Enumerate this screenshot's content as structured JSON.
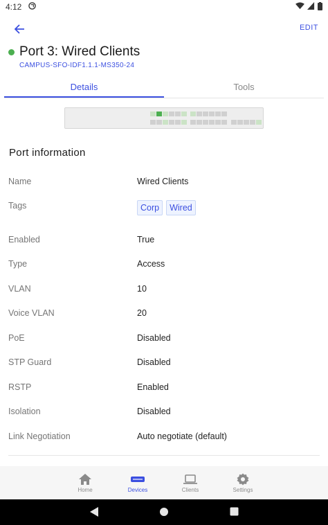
{
  "status_bar": {
    "time": "4:12"
  },
  "header": {
    "edit_label": "EDIT",
    "title": "Port 3: Wired Clients",
    "subtitle": "CAMPUS-SFO-IDF1.1.1-MS350-24",
    "status_color": "#4caf50"
  },
  "tabs": [
    {
      "label": "Details",
      "active": true
    },
    {
      "label": "Tools",
      "active": false
    }
  ],
  "section": {
    "title": "Port information"
  },
  "rows": {
    "name": {
      "label": "Name",
      "value": "Wired Clients"
    },
    "tags": {
      "label": "Tags",
      "values": [
        "Corp",
        "Wired"
      ]
    },
    "enabled": {
      "label": "Enabled",
      "value": "True"
    },
    "type": {
      "label": "Type",
      "value": "Access"
    },
    "vlan": {
      "label": "VLAN",
      "value": "10"
    },
    "voice_vlan": {
      "label": "Voice VLAN",
      "value": "20"
    },
    "poe": {
      "label": "PoE",
      "value": "Disabled"
    },
    "stp_guard": {
      "label": "STP Guard",
      "value": "Disabled"
    },
    "rstp": {
      "label": "RSTP",
      "value": "Enabled"
    },
    "isolation": {
      "label": "Isolation",
      "value": "Disabled"
    },
    "link_negotiation": {
      "label": "Link Negotiation",
      "value": "Auto negotiate (default)"
    }
  },
  "nav": [
    {
      "label": "Home",
      "icon": "home-icon",
      "active": false
    },
    {
      "label": "Devices",
      "icon": "devices-icon",
      "active": true
    },
    {
      "label": "Clients",
      "icon": "laptop-icon",
      "active": false
    },
    {
      "label": "Settings",
      "icon": "gear-icon",
      "active": false
    }
  ],
  "colors": {
    "accent": "#3b4fe0",
    "status_green": "#4caf50"
  }
}
